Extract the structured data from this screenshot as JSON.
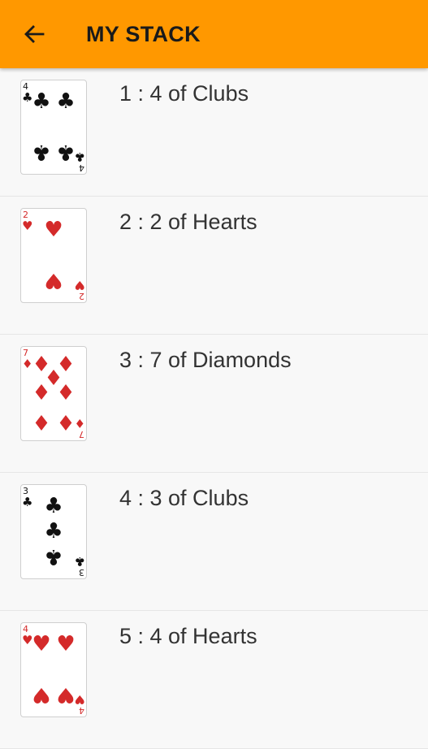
{
  "app_bar": {
    "title": "MY STACK",
    "back_icon": "arrow-left-icon",
    "background": "#ff9800"
  },
  "stack": [
    {
      "label": "1 : 4 of Clubs",
      "rank": "4",
      "suit": "clubs"
    },
    {
      "label": "2 : 2 of Hearts",
      "rank": "2",
      "suit": "hearts"
    },
    {
      "label": "3 : 7 of Diamonds",
      "rank": "7",
      "suit": "diamonds"
    },
    {
      "label": "4 : 3 of Clubs",
      "rank": "3",
      "suit": "clubs"
    },
    {
      "label": "5 : 4 of Hearts",
      "rank": "4",
      "suit": "hearts"
    }
  ],
  "colors": {
    "red_suit": "#d42a2a",
    "black_suit": "#111111"
  }
}
